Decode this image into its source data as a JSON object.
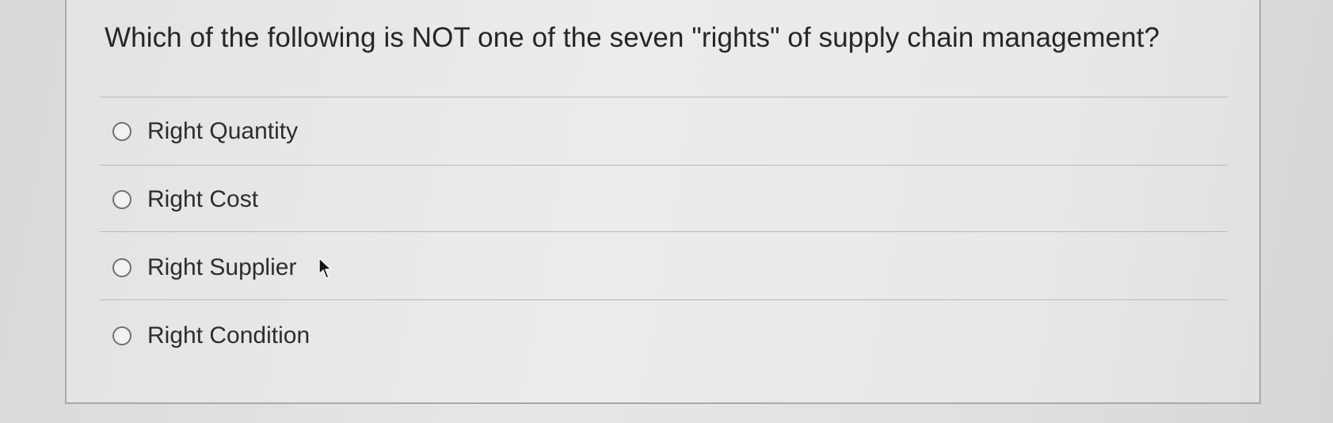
{
  "question": {
    "text": "Which of the following is NOT one of the seven \"rights\" of supply chain management?"
  },
  "options": [
    {
      "label": "Right Quantity",
      "selected": false
    },
    {
      "label": "Right Cost",
      "selected": false
    },
    {
      "label": "Right Supplier",
      "selected": false
    },
    {
      "label": "Right Condition",
      "selected": false
    }
  ],
  "cursor": {
    "icon": "arrow-pointer-icon"
  }
}
